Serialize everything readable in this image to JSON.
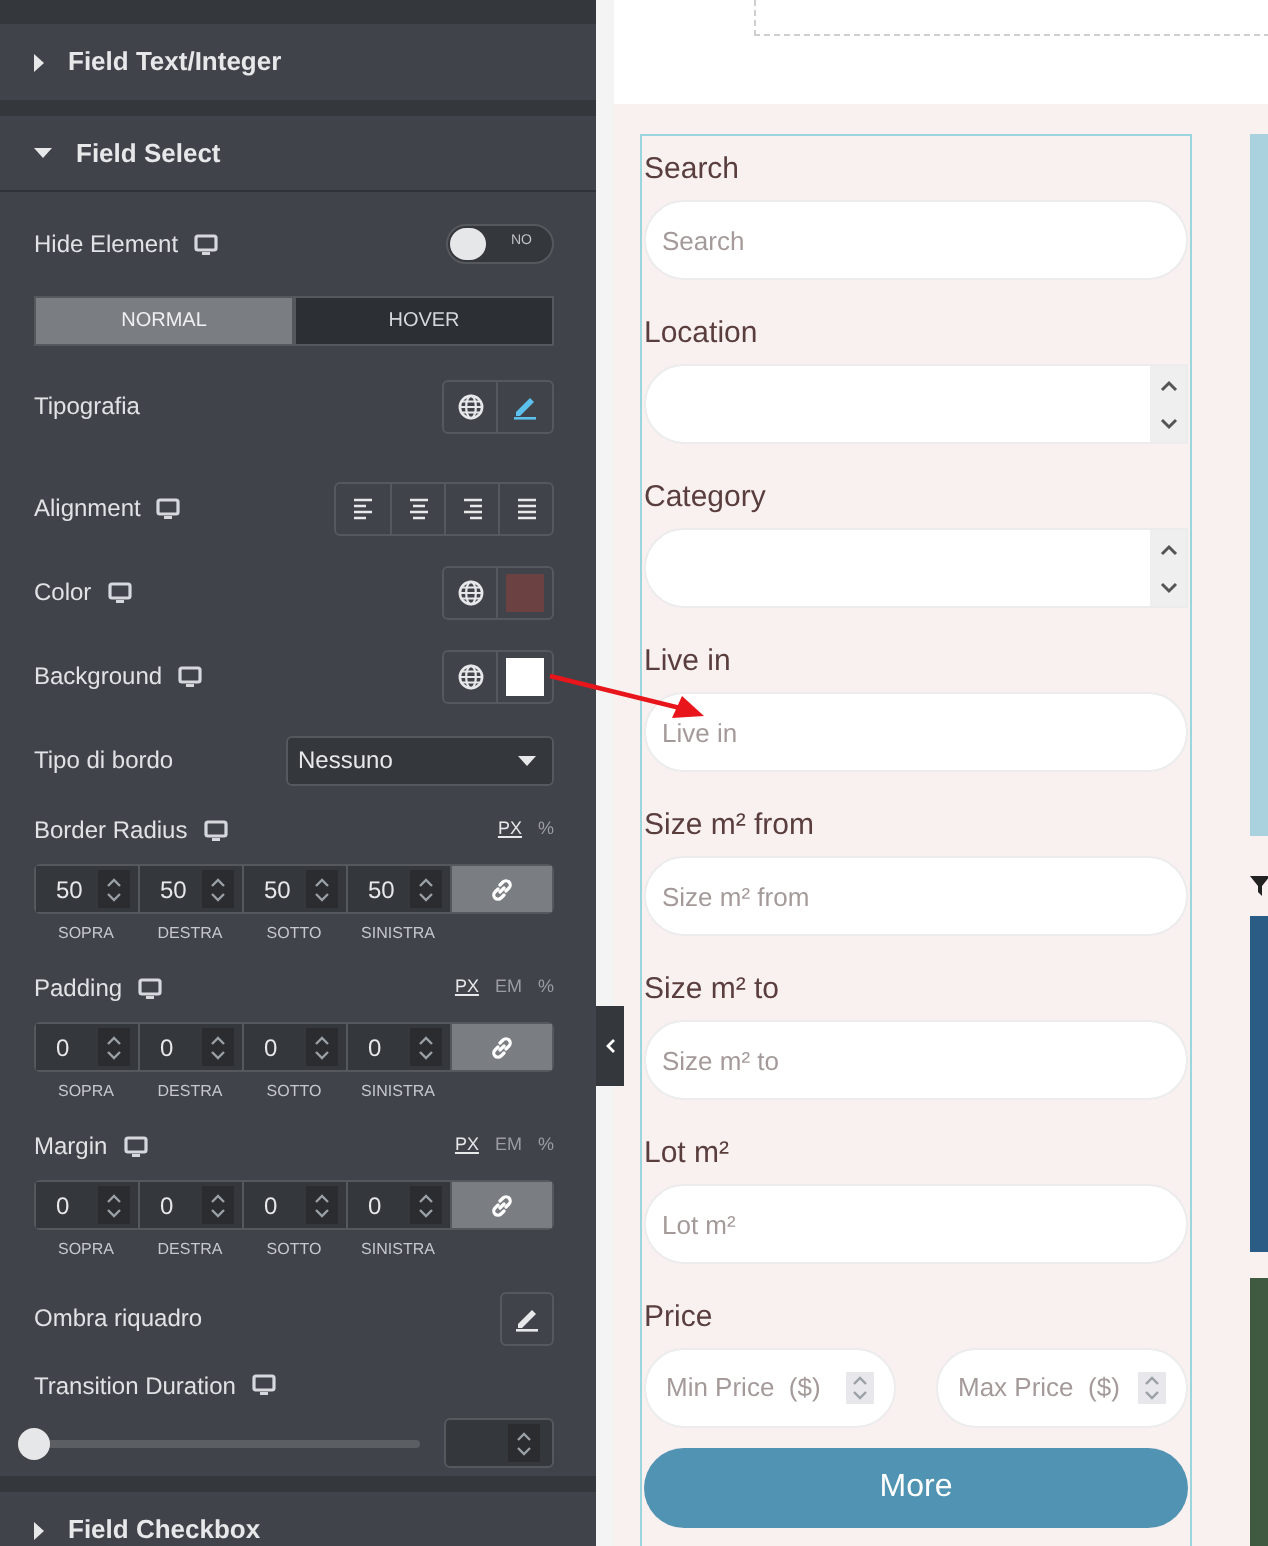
{
  "panel": {
    "sections": [
      {
        "title": "Field Text/Integer",
        "expanded": false
      },
      {
        "title": "Field Select",
        "expanded": true,
        "controls": [
          {
            "kind": "toggle",
            "label": "Hide Element",
            "responsive": true,
            "on": false,
            "text": "NO"
          },
          {
            "kind": "tabs",
            "tabs": [
              {
                "label": "NORMAL",
                "selected": true
              },
              {
                "label": "HOVER",
                "selected": false
              }
            ]
          },
          {
            "kind": "typography",
            "label": "Tipografia",
            "edited": true
          },
          {
            "kind": "alignment",
            "label": "Alignment",
            "responsive": true
          },
          {
            "kind": "color",
            "label": "Color",
            "responsive": true,
            "color": "#6b4141"
          },
          {
            "kind": "color",
            "label": "Background",
            "responsive": true,
            "color": "#ffffff"
          },
          {
            "kind": "select",
            "label": "Tipo di bordo",
            "value": "Nessuno"
          },
          {
            "kind": "dimensions",
            "label": "Border Radius",
            "responsive": true,
            "linked": true,
            "units": [
              {
                "label": "PX",
                "selected": true
              },
              {
                "label": "%",
                "selected": false
              }
            ],
            "inputs": [
              {
                "value": "50",
                "caption": "SOPRA"
              },
              {
                "value": "50",
                "caption": "DESTRA"
              },
              {
                "value": "50",
                "caption": "SOTTO"
              },
              {
                "value": "50",
                "caption": "SINISTRA"
              }
            ]
          },
          {
            "kind": "dimensions",
            "label": "Padding",
            "responsive": true,
            "linked": true,
            "units": [
              {
                "label": "PX",
                "selected": true
              },
              {
                "label": "EM",
                "selected": false
              },
              {
                "label": "%",
                "selected": false
              }
            ],
            "inputs": [
              {
                "value": "0",
                "caption": "SOPRA"
              },
              {
                "value": "0",
                "caption": "DESTRA"
              },
              {
                "value": "0",
                "caption": "SOTTO"
              },
              {
                "value": "0",
                "caption": "SINISTRA"
              }
            ]
          },
          {
            "kind": "dimensions",
            "label": "Margin",
            "responsive": true,
            "linked": true,
            "units": [
              {
                "label": "PX",
                "selected": true
              },
              {
                "label": "EM",
                "selected": false
              },
              {
                "label": "%",
                "selected": false
              }
            ],
            "inputs": [
              {
                "value": "0",
                "caption": "SOPRA"
              },
              {
                "value": "0",
                "caption": "DESTRA"
              },
              {
                "value": "0",
                "caption": "SOTTO"
              },
              {
                "value": "0",
                "caption": "SINISTRA"
              }
            ]
          },
          {
            "kind": "popover",
            "label": "Ombra riquadro"
          },
          {
            "kind": "slider",
            "label": "Transition Duration",
            "responsive": true,
            "level": 0
          }
        ]
      },
      {
        "title": "Field Checkbox",
        "expanded": false
      }
    ]
  },
  "form": {
    "fields": [
      {
        "kind": "text",
        "label": "Search",
        "placeholder": "Search"
      },
      {
        "kind": "spinner",
        "label": "Location"
      },
      {
        "kind": "spinner",
        "label": "Category"
      },
      {
        "kind": "text",
        "label": "Live in",
        "placeholder": "Live in"
      },
      {
        "kind": "text",
        "label": "Size m² from",
        "placeholder": "Size m² from"
      },
      {
        "kind": "text",
        "label": "Size m² to",
        "placeholder": "Size m² to"
      },
      {
        "kind": "text",
        "label": "Lot m²",
        "placeholder": "Lot m²"
      }
    ],
    "price": {
      "label": "Price",
      "min_placeholder": "Min Price  ($)",
      "max_placeholder": "Max Price  ($)"
    },
    "button": "More"
  }
}
